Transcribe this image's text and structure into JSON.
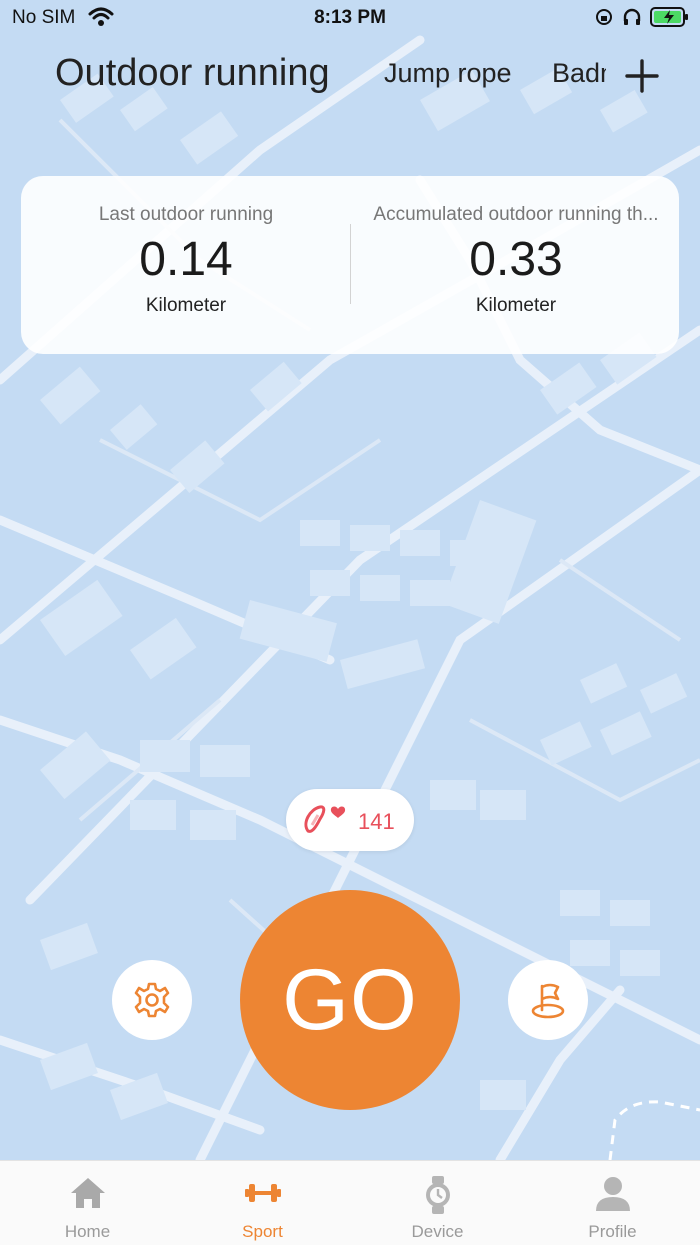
{
  "status_bar": {
    "carrier": "No SIM",
    "time": "8:13 PM"
  },
  "sport_tabs": [
    {
      "label": "Outdoor running",
      "active": true
    },
    {
      "label": "Jump rope",
      "active": false
    },
    {
      "label": "Badminton",
      "active": false
    }
  ],
  "stats": {
    "last": {
      "label": "Last outdoor running",
      "value": "0.14",
      "unit": "Kilometer"
    },
    "accumulated": {
      "label": "Accumulated outdoor running th...",
      "value": "0.33",
      "unit": "Kilometer"
    }
  },
  "heart_rate": {
    "value": "141",
    "icon": "band-heart-icon"
  },
  "go_button": {
    "label": "GO"
  },
  "controls": {
    "settings_icon": "gear-icon",
    "route_icon": "flag-icon"
  },
  "bottom_nav": [
    {
      "label": "Home",
      "icon": "home-icon",
      "active": false
    },
    {
      "label": "Sport",
      "icon": "dumbbell-icon",
      "active": true
    },
    {
      "label": "Device",
      "icon": "watch-icon",
      "active": false
    },
    {
      "label": "Profile",
      "icon": "person-icon",
      "active": false
    }
  ],
  "colors": {
    "accent": "#ed8533",
    "heart": "#e8505b",
    "map_water": "#c4dbf3",
    "map_block": "#d6e6f7",
    "road": "#e9f1fa"
  }
}
